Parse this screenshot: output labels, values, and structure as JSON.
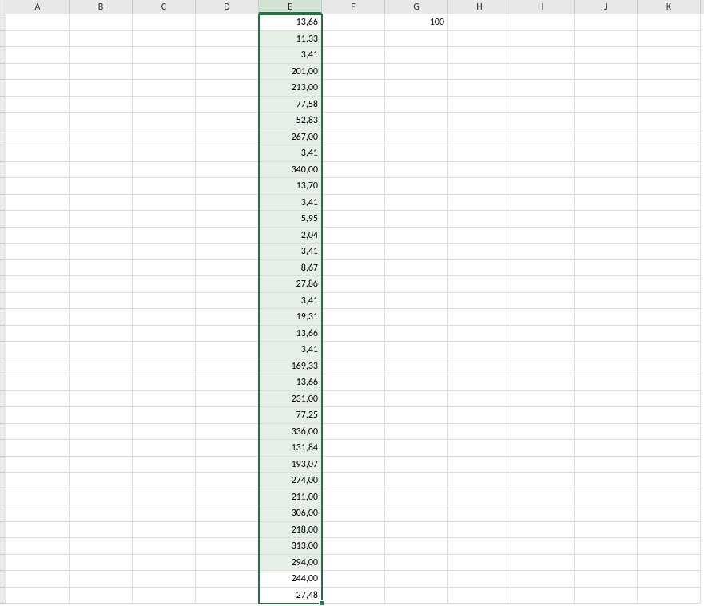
{
  "columns": [
    "A",
    "B",
    "C",
    "D",
    "E",
    "F",
    "G",
    "H",
    "I",
    "J",
    "K"
  ],
  "selected_column_index": 4,
  "selection": {
    "col": 4,
    "row_start": 0,
    "row_end": 33
  },
  "other_cells": {
    "G0": "100"
  },
  "column_e_values": [
    "13,66",
    "11,33",
    "3,41",
    "201,00",
    "213,00",
    "77,58",
    "52,83",
    "267,00",
    "3,41",
    "340,00",
    "13,70",
    "3,41",
    "5,95",
    "2,04",
    "3,41",
    "8,67",
    "27,86",
    "3,41",
    "19,31",
    "13,66",
    "3,41",
    "169,33",
    "13,66",
    "231,00",
    "77,25",
    "336,00",
    "131,84",
    "193,07",
    "274,00",
    "211,00",
    "306,00",
    "218,00",
    "313,00",
    "294,00",
    "244,00",
    "27,48"
  ],
  "visible_rows": 36
}
